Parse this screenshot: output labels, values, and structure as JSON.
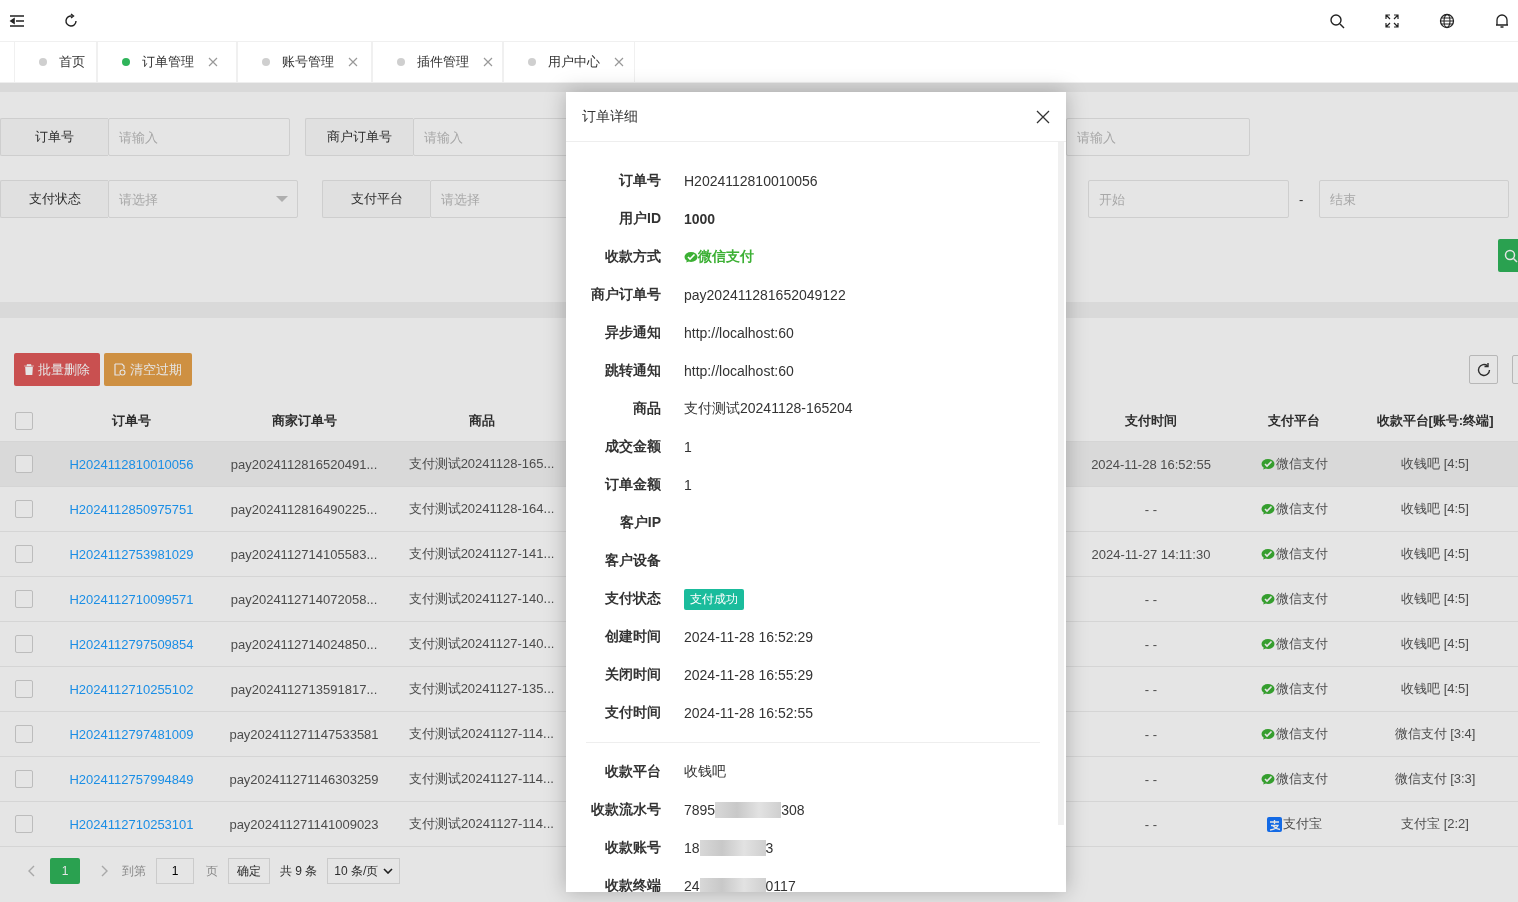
{
  "tabs": [
    {
      "label": "首页",
      "selected": false,
      "closable": false
    },
    {
      "label": "订单管理",
      "selected": true,
      "closable": true
    },
    {
      "label": "账号管理",
      "selected": false,
      "closable": true
    },
    {
      "label": "插件管理",
      "selected": false,
      "closable": true
    },
    {
      "label": "用户中心",
      "selected": false,
      "closable": true
    }
  ],
  "filter_rows": [
    [
      {
        "kind": "input",
        "label": "订单号",
        "placeholder": "请输入"
      },
      {
        "kind": "input",
        "label": "商户订单号",
        "placeholder": "请输入"
      },
      {
        "kind": "input",
        "placeholder": "请输入"
      }
    ],
    [
      {
        "kind": "select",
        "label": "支付状态",
        "placeholder": "请选择"
      },
      {
        "kind": "select",
        "label": "支付平台",
        "placeholder": "请选择"
      },
      {
        "kind": "range",
        "start_placeholder": "开始",
        "separator": "-",
        "end_placeholder": "结束"
      }
    ]
  ],
  "toolbar": [
    {
      "kind": "danger",
      "label": "批量删除"
    },
    {
      "kind": "warning",
      "label": "清空过期"
    }
  ],
  "table": {
    "all_checked": false,
    "columns": [
      "订单号",
      "商家订单号",
      "商品",
      "支付时间",
      "支付平台",
      "收款平台[账号:终端]"
    ],
    "rows": [
      {
        "checked": false,
        "hovered": true,
        "order_no": "H2024112810010056",
        "merchant_order_no": "pay2024112816520491...",
        "goods": "支付测试20241128-165...",
        "pay_time": "2024-11-28 16:52:55",
        "platform": {
          "kind": "wechat",
          "label": "微信支付"
        },
        "receiver": "收钱吧 [4:5]"
      },
      {
        "checked": false,
        "hovered": false,
        "order_no": "H2024112850975751",
        "merchant_order_no": "pay2024112816490225...",
        "goods": "支付测试20241128-164...",
        "pay_time": "- -",
        "platform": {
          "kind": "wechat",
          "label": "微信支付"
        },
        "receiver": "收钱吧 [4:5]"
      },
      {
        "checked": false,
        "hovered": false,
        "order_no": "H2024112753981029",
        "merchant_order_no": "pay2024112714105583...",
        "goods": "支付测试20241127-141...",
        "pay_time": "2024-11-27 14:11:30",
        "platform": {
          "kind": "wechat",
          "label": "微信支付"
        },
        "receiver": "收钱吧 [4:5]"
      },
      {
        "checked": false,
        "hovered": false,
        "order_no": "H2024112710099571",
        "merchant_order_no": "pay2024112714072058...",
        "goods": "支付测试20241127-140...",
        "pay_time": "- -",
        "platform": {
          "kind": "wechat",
          "label": "微信支付"
        },
        "receiver": "收钱吧 [4:5]"
      },
      {
        "checked": false,
        "hovered": false,
        "order_no": "H2024112797509854",
        "merchant_order_no": "pay2024112714024850...",
        "goods": "支付测试20241127-140...",
        "pay_time": "- -",
        "platform": {
          "kind": "wechat",
          "label": "微信支付"
        },
        "receiver": "收钱吧 [4:5]"
      },
      {
        "checked": false,
        "hovered": false,
        "order_no": "H2024112710255102",
        "merchant_order_no": "pay2024112713591817...",
        "goods": "支付测试20241127-135...",
        "pay_time": "- -",
        "platform": {
          "kind": "wechat",
          "label": "微信支付"
        },
        "receiver": "收钱吧 [4:5]"
      },
      {
        "checked": false,
        "hovered": false,
        "order_no": "H2024112797481009",
        "merchant_order_no": "pay202411271147533581",
        "goods": "支付测试20241127-114...",
        "pay_time": "- -",
        "platform": {
          "kind": "wechat",
          "label": "微信支付"
        },
        "receiver": "微信支付 [3:4]"
      },
      {
        "checked": false,
        "hovered": false,
        "order_no": "H2024112757994849",
        "merchant_order_no": "pay202411271146303259",
        "goods": "支付测试20241127-114...",
        "pay_time": "- -",
        "platform": {
          "kind": "wechat",
          "label": "微信支付"
        },
        "receiver": "微信支付 [3:3]"
      },
      {
        "checked": false,
        "hovered": false,
        "order_no": "H2024112710253101",
        "merchant_order_no": "pay202411271141009023",
        "goods": "支付测试20241127-114...",
        "pay_time": "- -",
        "platform": {
          "kind": "alipay",
          "label": "支付宝"
        },
        "receiver": "支付宝 [2:2]"
      }
    ]
  },
  "pagination": {
    "current_page": "1",
    "goto_label": "到第",
    "goto_value": "1",
    "page_suffix": "页",
    "confirm": "确定",
    "total": "共 9 条",
    "page_size": "10 条/页"
  },
  "modal": {
    "title": "订单详细",
    "sections": [
      [
        {
          "kind": "text",
          "label": "订单号",
          "value": "H2024112810010056"
        },
        {
          "kind": "bold",
          "label": "用户ID",
          "value": "1000"
        },
        {
          "kind": "wechat",
          "label": "收款方式",
          "value": "微信支付"
        },
        {
          "kind": "text",
          "label": "商户订单号",
          "value": "pay202411281652049122"
        },
        {
          "kind": "text",
          "label": "异步通知",
          "value": "http://localhost:60"
        },
        {
          "kind": "text",
          "label": "跳转通知",
          "value": "http://localhost:60"
        },
        {
          "kind": "text",
          "label": "商品",
          "value": "支付测试20241128-165204"
        },
        {
          "kind": "text",
          "label": "成交金额",
          "value": "1"
        },
        {
          "kind": "text",
          "label": "订单金额",
          "value": "1"
        },
        {
          "kind": "empty",
          "label": "客户IP"
        },
        {
          "kind": "empty",
          "label": "客户设备"
        },
        {
          "kind": "status",
          "label": "支付状态",
          "value": "支付成功"
        },
        {
          "kind": "text",
          "label": "创建时间",
          "value": "2024-11-28 16:52:29"
        },
        {
          "kind": "text",
          "label": "关闭时间",
          "value": "2024-11-28 16:55:29"
        },
        {
          "kind": "text",
          "label": "支付时间",
          "value": "2024-11-28 16:52:55"
        }
      ],
      [
        {
          "kind": "text",
          "label": "收款平台",
          "value": "收钱吧"
        },
        {
          "kind": "redacted",
          "label": "收款流水号",
          "value_start": "7895",
          "value_end": "308"
        },
        {
          "kind": "redacted",
          "label": "收款账号",
          "value_start": "18",
          "value_end": "3"
        },
        {
          "kind": "redacted",
          "label": "收款终端",
          "value_start": "24",
          "value_end": "0117"
        }
      ]
    ]
  }
}
